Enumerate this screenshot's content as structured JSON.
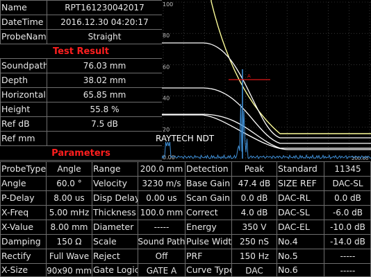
{
  "report": {
    "rows": [
      {
        "label": "Name",
        "value": "RPT161230042017"
      },
      {
        "label": "DateTime",
        "value": "2016.12.30  04:20:17"
      },
      {
        "label": "ProbeName",
        "value": "Straight"
      },
      {
        "header": "Test Result"
      },
      {
        "label": "Soundpath",
        "value": "76.03 mm"
      },
      {
        "label": "Depth",
        "value": "38.02 mm"
      },
      {
        "label": "Horizontal",
        "value": "65.85 mm"
      },
      {
        "label": "Height",
        "value": "55.8 %"
      },
      {
        "label": "Ref dB",
        "value": "7.5 dB"
      },
      {
        "label": "Ref mm",
        "value": ""
      },
      {
        "header": "Parameters"
      }
    ]
  },
  "params": {
    "rows": [
      [
        "ProbeType",
        "Angle",
        "Range",
        "200.0 mm",
        "Detection",
        "Peak",
        "Standard",
        "11345"
      ],
      [
        "Angle",
        "60.0 °",
        "Velocity",
        "3230 m/s",
        "Base Gain",
        "47.4 dB",
        "SIZE REF",
        "DAC-SL"
      ],
      [
        "P-Delay",
        "8.00 us",
        "Disp Delay",
        "0.00 us",
        "Scan Gain",
        "0.0 dB",
        "DAC-RL",
        "0.0 dB"
      ],
      [
        "X-Freq",
        "5.00 mHz",
        "Thickness",
        "100.0 mm",
        "Correct",
        "4.0 dB",
        "DAC-SL",
        "-6.0 dB"
      ],
      [
        "X-Value",
        "8.00 mm",
        "Diameter",
        "-----",
        "Energy",
        "350 V",
        "DAC-EL",
        "-10.0 dB"
      ],
      [
        "Damping",
        "150 Ω",
        "Scale",
        "Sound Path",
        "Pulse Width",
        "250 nS",
        "No.4",
        "-14.0 dB"
      ],
      [
        "Rectify",
        "Full Wave",
        "Reject",
        "Off",
        "PRF",
        "150 Hz",
        "No.5",
        "-----"
      ],
      [
        "X-Size",
        "90x90 mm",
        "Gate Logic",
        "GATE A",
        "Curve Type",
        "DAC",
        "No.6",
        "-----"
      ]
    ]
  },
  "ascan": {
    "y_labels": [
      "100",
      "80",
      "60",
      "40",
      "20",
      "0.00"
    ],
    "x_end_label": "200.00",
    "gate_label": "A",
    "watermark": "RAYTECH NDT",
    "colors": {
      "grid": "#5a5a5a",
      "signal": "#3f8fd6",
      "gate": "#e01818",
      "dac_main": "#ffff9a",
      "dac_curves": "#ffffff",
      "header_text": "#ff1e1e"
    }
  }
}
